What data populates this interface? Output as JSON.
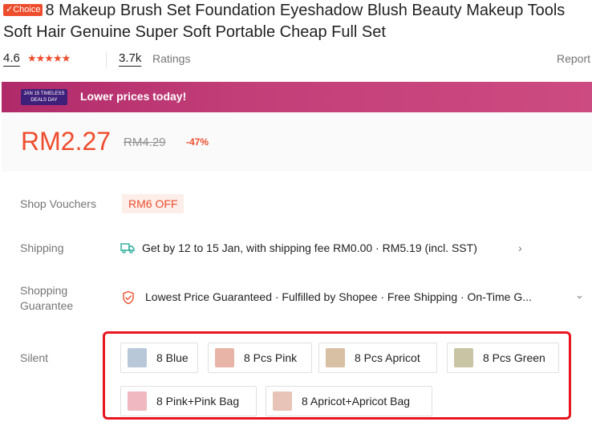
{
  "product": {
    "badge": "✓Choice",
    "title": "8 Makeup Brush Set Foundation Eyeshadow Blush Beauty Makeup Tools Soft Hair Genuine Super Soft Portable Cheap Full Set"
  },
  "ratings": {
    "value": "4.6",
    "stars": "★★★★★",
    "star_level": 4.6,
    "count": "3.7k",
    "count_label": "Ratings",
    "report": "Report"
  },
  "promo": {
    "logo_text": "JAN 15 TIMELESS DEALS DAY",
    "text": "Lower prices today!",
    "colors": {
      "start": "#b02a6a",
      "end": "#cc4b80",
      "logo": "#3e1f79"
    }
  },
  "price": {
    "current": "RM2.27",
    "original": "RM4.29",
    "discount": "-47%",
    "accent": "#ee4d2d"
  },
  "vouchers": {
    "label": "Shop Vouchers",
    "value": "RM6 OFF"
  },
  "shipping": {
    "label": "Shipping",
    "icon": "truck-icon",
    "text": "Get by 12 to 15 Jan, with shipping fee RM0.00 · RM5.19 (incl. SST)"
  },
  "guarantee": {
    "label_line1": "Shopping",
    "label_line2": "Guarantee",
    "icon": "shield-icon",
    "text": "Lowest Price Guaranteed · Fulfilled by Shopee · Free Shipping · On-Time G..."
  },
  "variations": {
    "label": "Silent",
    "options": [
      {
        "label": "8 Blue",
        "thumb": "#b8c8d8"
      },
      {
        "label": "8 Pcs Pink",
        "thumb": "#e8b4a8"
      },
      {
        "label": "8 Pcs Apricot",
        "thumb": "#d8c0a4"
      },
      {
        "label": "8 Pcs Green",
        "thumb": "#c8c4a4"
      },
      {
        "label": "8 Pink+Pink Bag",
        "thumb": "#f0b8c0"
      },
      {
        "label": "8 Apricot+Apricot Bag",
        "thumb": "#e8c4b8"
      }
    ],
    "highlight_color": "#e8161e"
  }
}
